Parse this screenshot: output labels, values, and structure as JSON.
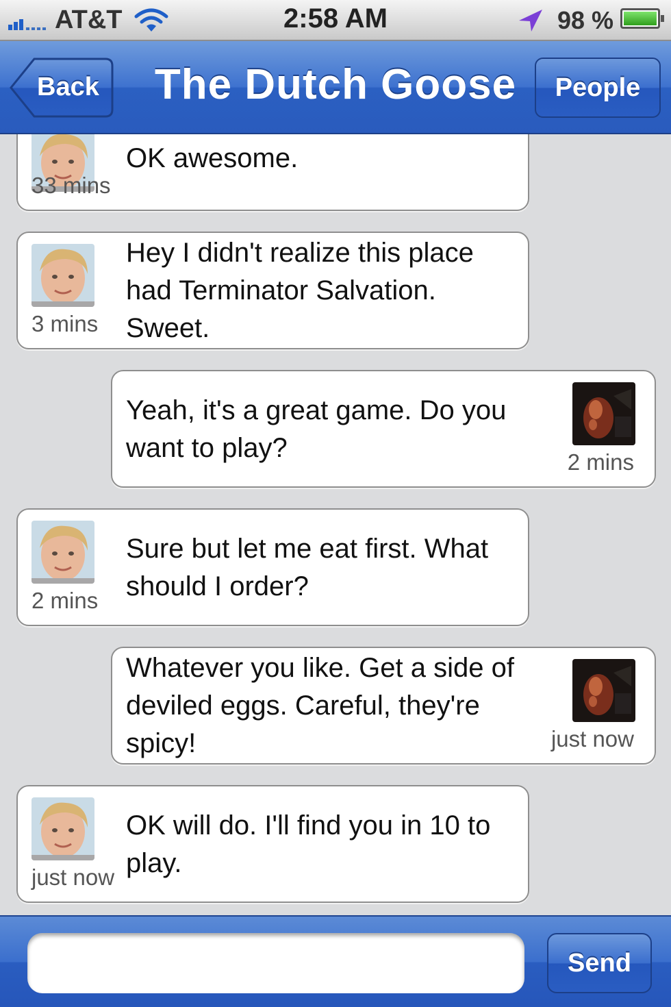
{
  "status_bar": {
    "carrier": "AT&T",
    "time": "2:58 AM",
    "battery_percent": "98 %",
    "battery_level": 0.98,
    "icons": [
      "signal-bars-icon",
      "wifi-icon",
      "location-arrow-icon",
      "battery-icon"
    ]
  },
  "nav": {
    "title": "The Dutch Goose",
    "back_label": "Back",
    "people_label": "People"
  },
  "messages": [
    {
      "sender": "other",
      "text": "OK awesome.",
      "time": "33 mins"
    },
    {
      "sender": "other",
      "text": "Hey I didn't realize this place had Terminator Salvation. Sweet.",
      "time": "3 mins"
    },
    {
      "sender": "me",
      "text": "Yeah, it's a great game. Do you want to play?",
      "time": "2 mins"
    },
    {
      "sender": "other",
      "text": "Sure but let me eat first. What should I order?",
      "time": "2 mins"
    },
    {
      "sender": "me",
      "text": "Whatever you like. Get a side of deviled eggs. Careful, they're spicy!",
      "time": "just now"
    },
    {
      "sender": "other",
      "text": "OK will do. I'll find you in 10 to play.",
      "time": "just now"
    }
  ],
  "compose": {
    "input_value": "",
    "send_label": "Send"
  },
  "colors": {
    "nav_blue": "#3e72cf",
    "background": "#dbdcde",
    "bubble": "#ffffff",
    "bubble_border": "#8e8e8e"
  }
}
